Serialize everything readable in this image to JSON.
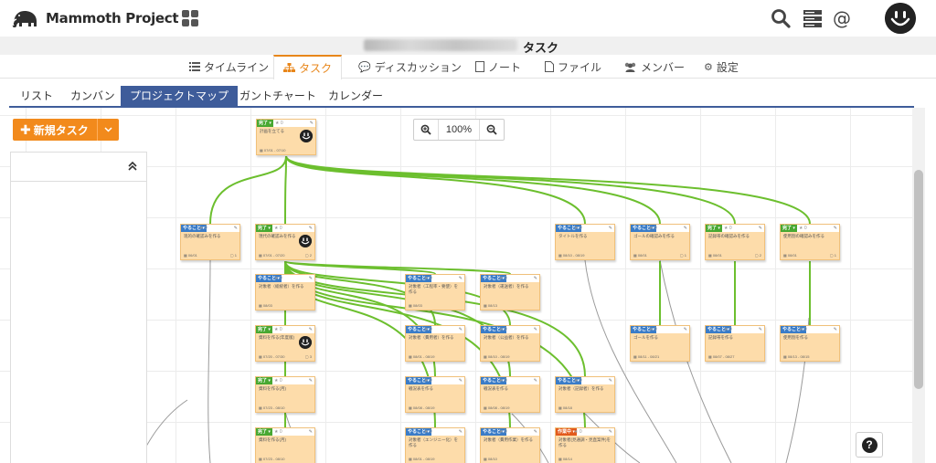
{
  "header": {
    "app_name": "Mammoth Project",
    "at_label": "@"
  },
  "title_bar": {
    "page_title": "タスク"
  },
  "main_tabs": [
    {
      "label": "タイムライン",
      "icon": "list-icon"
    },
    {
      "label": "タスク",
      "icon": "sitemap-icon",
      "active": true
    },
    {
      "label": "ディスカッション",
      "icon": "chat-icon"
    },
    {
      "label": "ノート",
      "icon": "note-icon"
    },
    {
      "label": "ファイル",
      "icon": "file-icon"
    },
    {
      "label": "メンバー",
      "icon": "users-icon"
    },
    {
      "label": "設定",
      "icon": "gear-icon"
    }
  ],
  "sub_tabs": [
    {
      "label": "リスト"
    },
    {
      "label": "カンバン"
    },
    {
      "label": "プロジェクトマップ",
      "active": true
    },
    {
      "label": "ガントチャート"
    },
    {
      "label": "カレンダー"
    }
  ],
  "toolbar": {
    "new_task_label": "新規タスク",
    "zoom_level": "100%"
  },
  "help": {
    "label": "?"
  },
  "colors": {
    "accent": "#e8861a",
    "subtab_active": "#3e5c9a",
    "card_bg": "#fddcaa",
    "link_line": "#6cbf2e",
    "status_todo": "#3a7cc8",
    "status_done": "#48a832",
    "status_doing": "#e25a1c"
  },
  "statuses": [
    "やること ▾",
    "完了 ▾",
    "作業中 ▾"
  ],
  "tasks": [
    {
      "status": 1,
      "title": "計画を立てる",
      "date": "07/01 - 07/10",
      "avatar": true
    },
    {
      "status": 0,
      "title": "现的の確認みを作る",
      "date": "06/01",
      "comments": "1"
    },
    {
      "status": 1,
      "title": "現代の確認みを作る",
      "date": "07/01 - 07/20",
      "comments": "2",
      "avatar": true
    },
    {
      "status": 0,
      "title": "タイトルを作る",
      "date": "08/10 - 08/19"
    },
    {
      "status": 0,
      "title": "ゴールの確認みを作る",
      "date": "08/01",
      "comments": "1"
    },
    {
      "status": 1,
      "title": "記録帯の確認みを作る",
      "date": "08/01",
      "comments": "2"
    },
    {
      "status": 1,
      "title": "使用割の確認みを作る",
      "date": "08/01",
      "comments": "1"
    },
    {
      "status": 0,
      "title": "対象者（総統者）を作る",
      "date": "08/03"
    },
    {
      "status": 0,
      "title": "対象者（工程率・要使）を作る",
      "date": "08/03"
    },
    {
      "status": 0,
      "title": "対象者（運送者）を作る",
      "date": "08/13"
    },
    {
      "status": 1,
      "title": "資料を作る(年度版)",
      "date": "07/20 - 07/30",
      "comments": "3",
      "avatar": true
    },
    {
      "status": 0,
      "title": "対象者（費用者）を作る",
      "date": "08/01 - 08/19"
    },
    {
      "status": 0,
      "title": "対象者（公益者）を作る",
      "date": "08/10 - 08/19"
    },
    {
      "status": 0,
      "title": "ゴールを作る",
      "date": "08/11 - 08/21"
    },
    {
      "status": 0,
      "title": "記録帯を作る",
      "date": "08/07 - 08/27"
    },
    {
      "status": 0,
      "title": "使用割を作る",
      "date": "08/13 - 08/15"
    },
    {
      "status": 1,
      "title": "資料を作る(月)",
      "date": "07/23 - 08/10"
    },
    {
      "status": 0,
      "title": "戦況表を作る",
      "date": "08/08 - 08/19"
    },
    {
      "status": 0,
      "title": "戦況表を作る",
      "date": "08/08 - 08/19"
    },
    {
      "status": 0,
      "title": "対象者（記録者）を作る",
      "date": "08/18"
    },
    {
      "status": 1,
      "title": "資料を作る(月)",
      "date": "07/23 - 08/10"
    },
    {
      "status": 0,
      "title": "対象者（エンジニー化）を作る",
      "date": "08/01 - 08/19"
    },
    {
      "status": 0,
      "title": "対象者（費用作業）を作る",
      "date": "08/10"
    },
    {
      "status": 2,
      "title": "対象者(見通調・見直案件)を作る",
      "date": "08/14"
    }
  ]
}
